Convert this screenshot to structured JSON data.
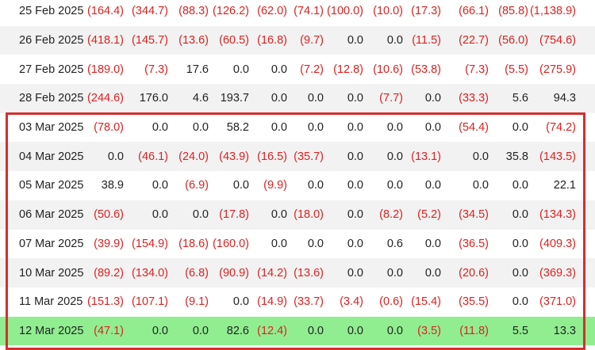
{
  "rows": [
    {
      "date": "25 Feb 2025",
      "values": [
        "(164.4)",
        "(344.7)",
        "(88.3)",
        "(126.2)",
        "(62.0)",
        "(74.1)",
        "(100.0)",
        "(10.0)",
        "(17.3)",
        "(66.1)",
        "(85.8)",
        "(1,138.9)"
      ]
    },
    {
      "date": "26 Feb 2025",
      "values": [
        "(418.1)",
        "(145.7)",
        "(13.6)",
        "(60.5)",
        "(16.8)",
        "(9.7)",
        "0.0",
        "0.0",
        "(11.5)",
        "(22.7)",
        "(56.0)",
        "(754.6)"
      ]
    },
    {
      "date": "27 Feb 2025",
      "values": [
        "(189.0)",
        "(7.3)",
        "17.6",
        "0.0",
        "0.0",
        "(7.2)",
        "(12.8)",
        "(10.6)",
        "(53.8)",
        "(7.3)",
        "(5.5)",
        "(275.9)"
      ]
    },
    {
      "date": "28 Feb 2025",
      "values": [
        "(244.6)",
        "176.0",
        "4.6",
        "193.7",
        "0.0",
        "0.0",
        "0.0",
        "(7.7)",
        "0.0",
        "(33.3)",
        "5.6",
        "94.3"
      ]
    },
    {
      "date": "03 Mar 2025",
      "values": [
        "(78.0)",
        "0.0",
        "0.0",
        "58.2",
        "0.0",
        "0.0",
        "0.0",
        "0.0",
        "0.0",
        "(54.4)",
        "0.0",
        "(74.2)"
      ]
    },
    {
      "date": "04 Mar 2025",
      "values": [
        "0.0",
        "(46.1)",
        "(24.0)",
        "(43.9)",
        "(16.5)",
        "(35.7)",
        "0.0",
        "0.0",
        "(13.1)",
        "0.0",
        "35.8",
        "(143.5)"
      ]
    },
    {
      "date": "05 Mar 2025",
      "values": [
        "38.9",
        "0.0",
        "(6.9)",
        "0.0",
        "(9.9)",
        "0.0",
        "0.0",
        "0.0",
        "0.0",
        "0.0",
        "0.0",
        "22.1"
      ]
    },
    {
      "date": "06 Mar 2025",
      "values": [
        "(50.6)",
        "0.0",
        "0.0",
        "(17.8)",
        "0.0",
        "(18.0)",
        "0.0",
        "(8.2)",
        "(5.2)",
        "(34.5)",
        "0.0",
        "(134.3)"
      ]
    },
    {
      "date": "07 Mar 2025",
      "values": [
        "(39.9)",
        "(154.9)",
        "(18.6)",
        "(160.0)",
        "0.0",
        "0.0",
        "0.0",
        "0.6",
        "0.0",
        "(36.5)",
        "0.0",
        "(409.3)"
      ]
    },
    {
      "date": "10 Mar 2025",
      "values": [
        "(89.2)",
        "(134.0)",
        "(6.8)",
        "(90.9)",
        "(14.2)",
        "(13.6)",
        "0.0",
        "0.0",
        "0.0",
        "(20.6)",
        "0.0",
        "(369.3)"
      ]
    },
    {
      "date": "11 Mar 2025",
      "values": [
        "(151.3)",
        "(107.1)",
        "(9.1)",
        "0.0",
        "(14.9)",
        "(33.7)",
        "(3.4)",
        "(0.6)",
        "(15.4)",
        "(35.5)",
        "0.0",
        "(371.0)"
      ]
    },
    {
      "date": "12 Mar 2025",
      "values": [
        "(47.1)",
        "0.0",
        "0.0",
        "82.6",
        "(12.4)",
        "0.0",
        "0.0",
        "0.0",
        "(3.5)",
        "(11.8)",
        "5.5",
        "13.3"
      ]
    }
  ],
  "highlight_row": "12 Mar 2025",
  "colors": {
    "negative": "#e02020",
    "positive": "#222222",
    "highlight_bg": "#90ee90",
    "frame": "#d32f2f"
  }
}
